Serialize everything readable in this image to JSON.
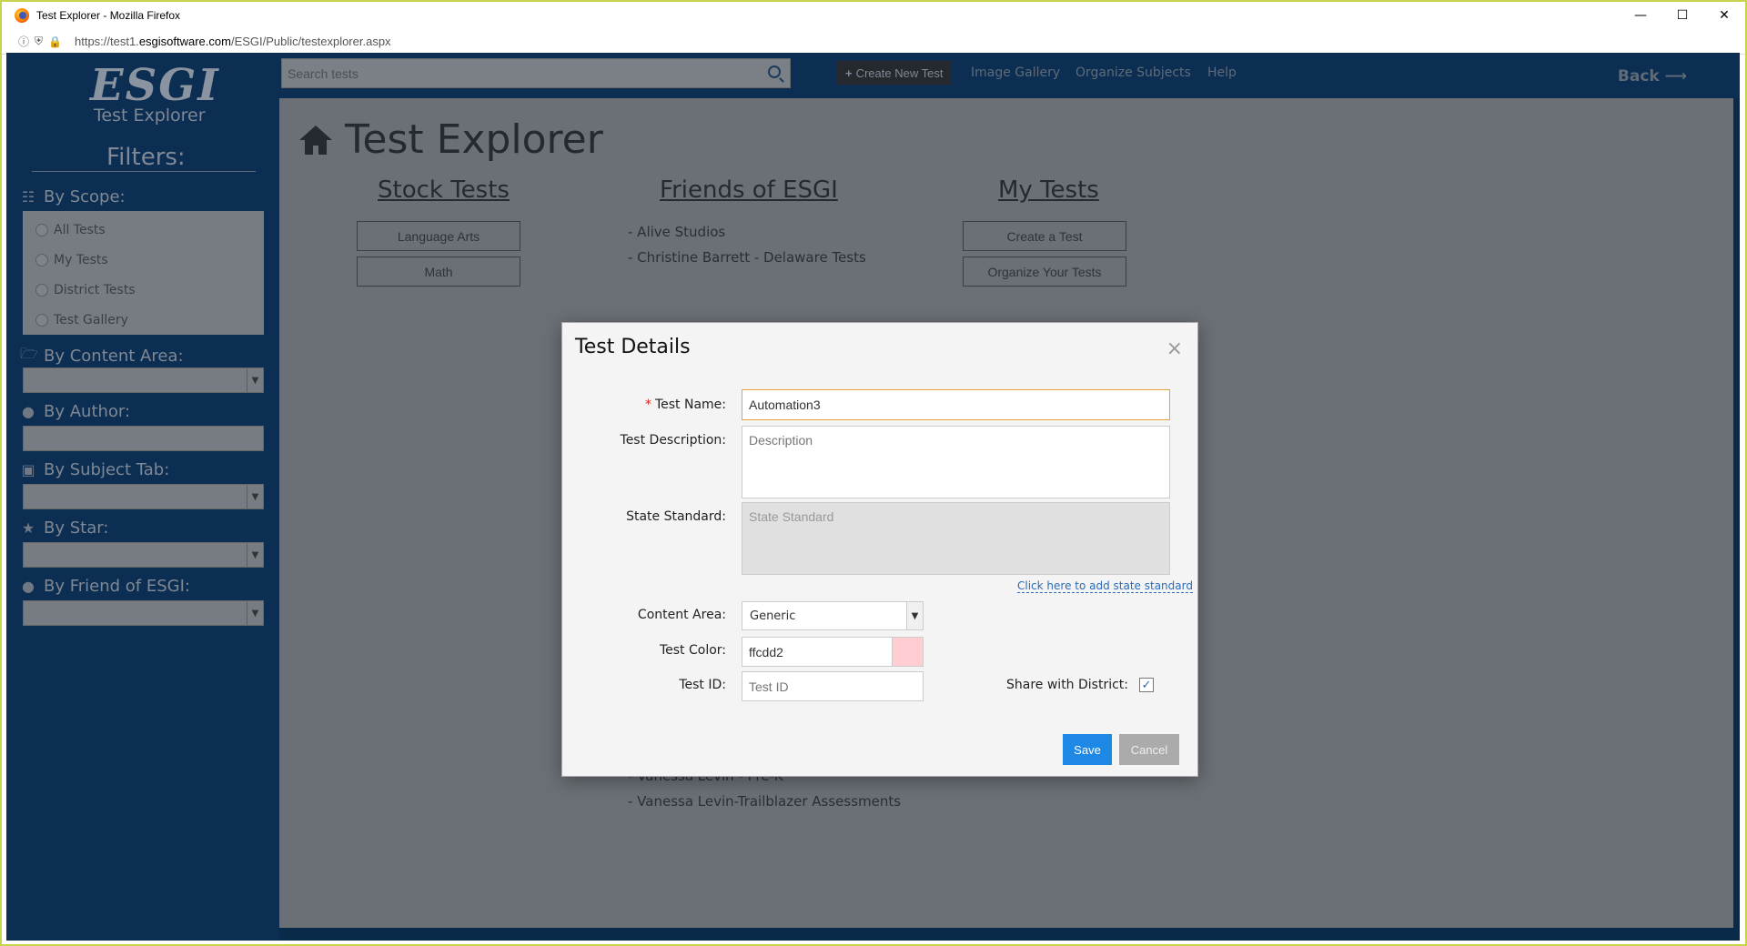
{
  "browser": {
    "window_title": "Test Explorer - Mozilla Firefox",
    "url_prefix": "https://test1.",
    "url_domain": "esgisoftware.com",
    "url_path": "/ESGI/Public/testexplorer.aspx"
  },
  "sidebar": {
    "logo": "ESGI",
    "logo_sub": "Test Explorer",
    "filters_title": "Filters:",
    "scope_label": "By Scope:",
    "scope_items": [
      "All Tests",
      "My Tests",
      "District Tests",
      "Test Gallery"
    ],
    "content_area_label": "By Content Area:",
    "author_label": "By Author:",
    "subject_tab_label": "By Subject Tab:",
    "star_label": "By Star:",
    "friend_label": "By Friend of ESGI:"
  },
  "topnav": {
    "search_placeholder": "Search tests",
    "create_label": "Create New Test",
    "image_gallery": "Image Gallery",
    "organize_subjects": "Organize Subjects",
    "help": "Help",
    "back": "Back"
  },
  "main": {
    "title": "Test Explorer",
    "stock_title": "Stock Tests",
    "stock_buttons": [
      "Language Arts",
      "Math"
    ],
    "friends_title": "Friends of ESGI",
    "friends_top": [
      "- Alive Studios",
      "- Christine Barrett - Delaware Tests"
    ],
    "friends_bottom": [
      "- Vanessa Levin - Pre-K",
      "- Vanessa Levin-Trailblazer Assessments"
    ],
    "my_title": "My Tests",
    "my_buttons": [
      "Create a Test",
      "Organize Your Tests"
    ]
  },
  "modal": {
    "title": "Test Details",
    "close": "×",
    "name_required": "*",
    "name_label": "Test Name:",
    "name_value": "Automation3",
    "desc_label": "Test Description:",
    "desc_placeholder": "Description",
    "state_label": "State Standard:",
    "state_placeholder": "State Standard",
    "state_link": "Click here to add state standard",
    "content_label": "Content Area:",
    "content_value": "Generic",
    "color_label": "Test Color:",
    "color_value": "ffcdd2",
    "color_swatch": "#ffcdd2",
    "id_label": "Test ID:",
    "id_placeholder": "Test ID",
    "share_label": "Share with District:",
    "share_checked": "✓",
    "save": "Save",
    "cancel": "Cancel"
  }
}
